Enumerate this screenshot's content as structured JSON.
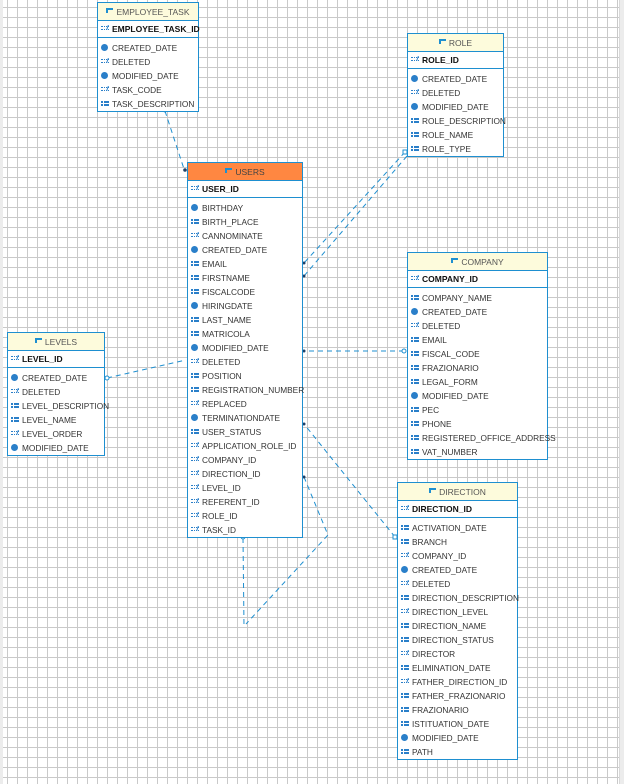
{
  "colors": {
    "border": "#1e8fd0",
    "header": "#fdfbdc",
    "main_header": "#ff8741",
    "link": "#1e8fd0"
  },
  "tables": [
    {
      "id": "employee_task",
      "name": "EMPLOYEE_TASK",
      "pk": "EMPLOYEE_TASK_ID",
      "columns": [
        {
          "name": "CREATED_DATE",
          "icon": "date"
        },
        {
          "name": "DELETED",
          "icon": "num"
        },
        {
          "name": "MODIFIED_DATE",
          "icon": "date"
        },
        {
          "name": "TASK_CODE",
          "icon": "num"
        },
        {
          "name": "TASK_DESCRIPTION",
          "icon": "text"
        }
      ]
    },
    {
      "id": "role",
      "name": "ROLE",
      "pk": "ROLE_ID",
      "columns": [
        {
          "name": "CREATED_DATE",
          "icon": "date"
        },
        {
          "name": "DELETED",
          "icon": "num"
        },
        {
          "name": "MODIFIED_DATE",
          "icon": "date"
        },
        {
          "name": "ROLE_DESCRIPTION",
          "icon": "text"
        },
        {
          "name": "ROLE_NAME",
          "icon": "text"
        },
        {
          "name": "ROLE_TYPE",
          "icon": "text"
        }
      ]
    },
    {
      "id": "users",
      "name": "USERS",
      "pk": "USER_ID",
      "main": true,
      "columns": [
        {
          "name": "BIRTHDAY",
          "icon": "date"
        },
        {
          "name": "BIRTH_PLACE",
          "icon": "text"
        },
        {
          "name": "CANNOMINATE",
          "icon": "num"
        },
        {
          "name": "CREATED_DATE",
          "icon": "date"
        },
        {
          "name": "EMAIL",
          "icon": "text"
        },
        {
          "name": "FIRSTNAME",
          "icon": "text"
        },
        {
          "name": "FISCALCODE",
          "icon": "text"
        },
        {
          "name": "HIRINGDATE",
          "icon": "date"
        },
        {
          "name": "LAST_NAME",
          "icon": "text"
        },
        {
          "name": "MATRICOLA",
          "icon": "text"
        },
        {
          "name": "MODIFIED_DATE",
          "icon": "date"
        },
        {
          "name": "DELETED",
          "icon": "num"
        },
        {
          "name": "POSITION",
          "icon": "text"
        },
        {
          "name": "REGISTRATION_NUMBER",
          "icon": "text"
        },
        {
          "name": "REPLACED",
          "icon": "num"
        },
        {
          "name": "TERMINATIONDATE",
          "icon": "date"
        },
        {
          "name": "USER_STATUS",
          "icon": "text"
        },
        {
          "name": "APPLICATION_ROLE_ID",
          "icon": "num"
        },
        {
          "name": "COMPANY_ID",
          "icon": "num"
        },
        {
          "name": "DIRECTION_ID",
          "icon": "num"
        },
        {
          "name": "LEVEL_ID",
          "icon": "num"
        },
        {
          "name": "REFERENT_ID",
          "icon": "num"
        },
        {
          "name": "ROLE_ID",
          "icon": "num"
        },
        {
          "name": "TASK_ID",
          "icon": "num"
        }
      ]
    },
    {
      "id": "company",
      "name": "COMPANY",
      "pk": "COMPANY_ID",
      "columns": [
        {
          "name": "COMPANY_NAME",
          "icon": "text"
        },
        {
          "name": "CREATED_DATE",
          "icon": "date"
        },
        {
          "name": "DELETED",
          "icon": "num"
        },
        {
          "name": "EMAIL",
          "icon": "text"
        },
        {
          "name": "FISCAL_CODE",
          "icon": "text"
        },
        {
          "name": "FRAZIONARIO",
          "icon": "text"
        },
        {
          "name": "LEGAL_FORM",
          "icon": "text"
        },
        {
          "name": "MODIFIED_DATE",
          "icon": "date"
        },
        {
          "name": "PEC",
          "icon": "text"
        },
        {
          "name": "PHONE",
          "icon": "text"
        },
        {
          "name": "REGISTERED_OFFICE_ADDRESS",
          "icon": "text"
        },
        {
          "name": "VAT_NUMBER",
          "icon": "text"
        }
      ]
    },
    {
      "id": "levels",
      "name": "LEVELS",
      "pk": "LEVEL_ID",
      "columns": [
        {
          "name": "CREATED_DATE",
          "icon": "date"
        },
        {
          "name": "DELETED",
          "icon": "num"
        },
        {
          "name": "LEVEL_DESCRIPTION",
          "icon": "text"
        },
        {
          "name": "LEVEL_NAME",
          "icon": "text"
        },
        {
          "name": "LEVEL_ORDER",
          "icon": "num"
        },
        {
          "name": "MODIFIED_DATE",
          "icon": "date"
        }
      ]
    },
    {
      "id": "direction",
      "name": "DIRECTION",
      "pk": "DIRECTION_ID",
      "columns": [
        {
          "name": "ACTIVATION_DATE",
          "icon": "text"
        },
        {
          "name": "BRANCH",
          "icon": "text"
        },
        {
          "name": "COMPANY_ID",
          "icon": "num"
        },
        {
          "name": "CREATED_DATE",
          "icon": "date"
        },
        {
          "name": "DELETED",
          "icon": "num"
        },
        {
          "name": "DIRECTION_DESCRIPTION",
          "icon": "text"
        },
        {
          "name": "DIRECTION_LEVEL",
          "icon": "num"
        },
        {
          "name": "DIRECTION_NAME",
          "icon": "text"
        },
        {
          "name": "DIRECTION_STATUS",
          "icon": "text"
        },
        {
          "name": "DIRECTOR",
          "icon": "num"
        },
        {
          "name": "ELIMINATION_DATE",
          "icon": "text"
        },
        {
          "name": "FATHER_DIRECTION_ID",
          "icon": "num"
        },
        {
          "name": "FATHER_FRAZIONARIO",
          "icon": "text"
        },
        {
          "name": "FRAZIONARIO",
          "icon": "text"
        },
        {
          "name": "ISTITUATION_DATE",
          "icon": "text"
        },
        {
          "name": "MODIFIED_DATE",
          "icon": "date"
        },
        {
          "name": "PATH",
          "icon": "text"
        }
      ]
    }
  ],
  "relationships": [
    {
      "from": "EMPLOYEE_TASK",
      "to": "USERS"
    },
    {
      "from": "ROLE",
      "to": "USERS"
    },
    {
      "from": "ROLE",
      "to": "USERS"
    },
    {
      "from": "COMPANY",
      "to": "USERS"
    },
    {
      "from": "LEVELS",
      "to": "USERS"
    },
    {
      "from": "DIRECTION",
      "to": "USERS"
    },
    {
      "from": "USERS",
      "to": "USERS"
    }
  ]
}
